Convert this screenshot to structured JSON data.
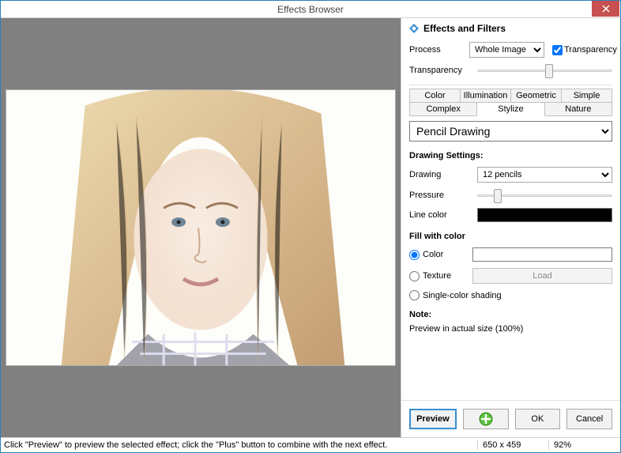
{
  "title": "Effects Browser",
  "panel_header": "Effects and Filters",
  "process": {
    "label": "Process",
    "value": "Whole Image"
  },
  "transparency_checkbox": {
    "label": "Transparency",
    "checked": true
  },
  "transparency_slider": {
    "label": "Transparency",
    "pos": 50
  },
  "tabs_row1": [
    "Color",
    "Illumination",
    "Geometric",
    "Simple"
  ],
  "tabs_row2": [
    "Complex",
    "Stylize",
    "Nature"
  ],
  "active_tab": "Stylize",
  "effect_select": "Pencil Drawing",
  "drawing_settings_title": "Drawing Settings:",
  "drawing": {
    "label": "Drawing",
    "value": "12 pencils"
  },
  "pressure": {
    "label": "Pressure",
    "pos": 12
  },
  "line_color": {
    "label": "Line color",
    "hex": "#000000"
  },
  "fill_title": "Fill with color",
  "fill_options": {
    "color": {
      "label": "Color",
      "selected": true
    },
    "texture": {
      "label": "Texture",
      "selected": false
    },
    "single": {
      "label": "Single-color shading",
      "selected": false
    }
  },
  "load_btn": "Load",
  "note_label": "Note:",
  "note_text": "Preview in actual size (100%)",
  "buttons": {
    "preview": "Preview",
    "ok": "OK",
    "cancel": "Cancel"
  },
  "status": {
    "msg": "Click \"Preview\" to preview the selected effect; click the \"Plus\" button to combine with the next effect.",
    "dims": "650 x 459",
    "zoom": "92%"
  },
  "colors": {
    "accent_red": "#c75050",
    "accent_blue": "#3a8fcf"
  }
}
